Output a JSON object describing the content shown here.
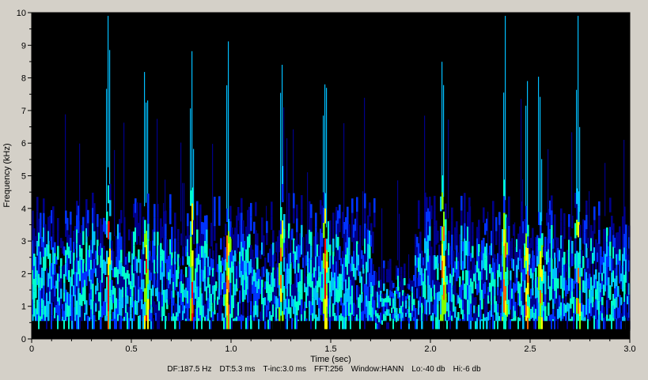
{
  "chart_data": {
    "type": "heatmap",
    "xlabel": "Time (sec)",
    "ylabel": "Frequency (kHz)",
    "xlim": [
      0,
      3.0
    ],
    "ylim": [
      0,
      10
    ],
    "x_ticks": [
      "0",
      "0.5",
      "1.0",
      "1.5",
      "2.0",
      "2.5",
      "3.0"
    ],
    "y_ticks": [
      "0",
      "1",
      "2",
      "3",
      "4",
      "5",
      "6",
      "7",
      "8",
      "9",
      "10"
    ],
    "colormap": [
      "#000000",
      "#00008b",
      "#0033ff",
      "#00bfff",
      "#00ffcc",
      "#7fff00",
      "#ffff00",
      "#ff6600",
      "#ff0000"
    ],
    "dominant_band_khz": [
      0,
      4.5
    ],
    "strong_transients_sec": [
      0.38,
      0.57,
      0.8,
      0.98,
      1.25,
      1.47,
      2.06,
      2.37,
      2.48,
      2.55,
      2.74
    ]
  },
  "footer": {
    "df": "DF:187.5 Hz",
    "dt": "DT:5.3 ms",
    "tinc": "T-inc:3.0 ms",
    "fft": "FFT:256",
    "window": "Window:HANN",
    "lo": "Lo:-40 db",
    "hi": "Hi:-6 db"
  }
}
